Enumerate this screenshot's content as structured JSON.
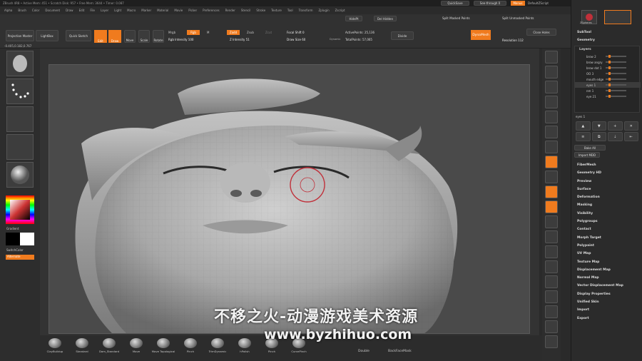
{
  "titlebar": {
    "text": "ZBrush 4R8    •  Active Mem: 451  •  Scratch Disk: 957  •  Free Mem: 3644  •  Timer: 0.087",
    "quicksave": "QuickSave",
    "see_through": "See-through 0",
    "menus_label": "Menus",
    "default_script": "DefaultZScript"
  },
  "menubar": [
    "Alpha",
    "Brush",
    "Color",
    "Document",
    "Draw",
    "Edit",
    "File",
    "Layer",
    "Light",
    "Macro",
    "Marker",
    "Material",
    "Movie",
    "Picker",
    "Preferences",
    "Render",
    "Stencil",
    "Stroke",
    "Texture",
    "Tool",
    "Transform",
    "Zplugin",
    "Zscript"
  ],
  "toolbar": {
    "projection_master": "Projection Master",
    "lightbox": "LightBox",
    "quick_sketch": "Quick Sketch",
    "edit": "Edit",
    "draw": "Draw",
    "move": "Move",
    "scale": "Scale",
    "rotate": "Rotate",
    "mrgb": "Mrgb",
    "rgb": "Rgb",
    "m": "M",
    "zadd": "Zadd",
    "zsub": "Zsub",
    "zcut": "Zcut",
    "rgb_intensity": "Rgb Intensity 100",
    "z_intensity": "Z Intensity 51",
    "focal_shift": "Focal Shift 0",
    "draw_size": "Draw Size 60",
    "dynamic": "Dynamic",
    "active_points": "ActivePoints: 25,136",
    "total_points": "TotalPoints: 57,065",
    "divide": "Divide",
    "dynamesh": "DynaMesh",
    "resolution": "Resolution 112",
    "close_holes": "Close Holes",
    "split_masked": "Split Masked Points",
    "split_unmasked": "Split Unmasked Points",
    "del_hidden": "Del Hidden",
    "hide_pt": "HidePt"
  },
  "coords": "-0.405,0.182,0.767",
  "left_panel": {
    "gradient": "Gradient",
    "switch_color": "SwitchColor",
    "alternate": "Alternate"
  },
  "bottom_brushes": [
    "ClayBuildup",
    "Standard",
    "Dam_Standard",
    "Move",
    "Move Topological",
    "Pinch",
    "TrimDynamic",
    "hPolish",
    "Pinch",
    "CurvePinch"
  ],
  "bottom_extra": {
    "double": "Double",
    "backface": "BackFaceMask"
  },
  "right_shelf": [
    "SPix 3",
    "Scroll",
    "Zoom",
    "Actual",
    "AAHalf",
    "Persp",
    "Floor",
    "Local",
    "L.Sym",
    "Xyz",
    "Frame",
    "Move",
    "Scale",
    "Rotate",
    "Line Fill",
    "PolyF",
    "Transp",
    "Ghost",
    "Solo",
    "Xpose"
  ],
  "right_panel": {
    "zspheres": "ZSpheres",
    "subtool": "SubTool",
    "geometry": "Geometry",
    "layers": "Layers",
    "layer_rows": [
      "brow 2",
      "brow angry",
      "brow dot 1",
      "OO 3",
      "mouth edge",
      "eyes 1",
      "nm 1",
      "eye 21"
    ],
    "selected_layer": "eyes 1",
    "bake_all": "Bake All",
    "import_mdd": "Import MDD",
    "items": [
      "FiberMesh",
      "Geometry HD",
      "Preview",
      "Surface",
      "Deformation",
      "Masking",
      "Visibility",
      "Polygroups",
      "Contact",
      "Morph Target",
      "Polypaint",
      "UV Map",
      "Texture Map",
      "Displacement Map",
      "Normal Map",
      "Vector Displacement Map",
      "Display Properties",
      "Unified Skin",
      "Import",
      "Export"
    ]
  },
  "watermark": {
    "cn": "不移之火-动漫游戏美术资源",
    "url": "www.byzhihuo.com"
  },
  "colors": {
    "accent": "#f07b1e",
    "bg": "#2a2a2a",
    "canvas": "#4a4a4a"
  }
}
